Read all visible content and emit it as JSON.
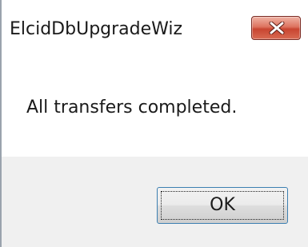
{
  "window": {
    "title": "ElcidDbUpgradeWiz"
  },
  "dialog": {
    "message": "All transfers completed."
  },
  "buttons": {
    "ok_label": "OK"
  },
  "colors": {
    "close_button": "#c84531",
    "ok_button_border": "#3c7fb1",
    "button_area_bg": "#f0f0f0"
  },
  "icons": {
    "close": "close-icon"
  }
}
